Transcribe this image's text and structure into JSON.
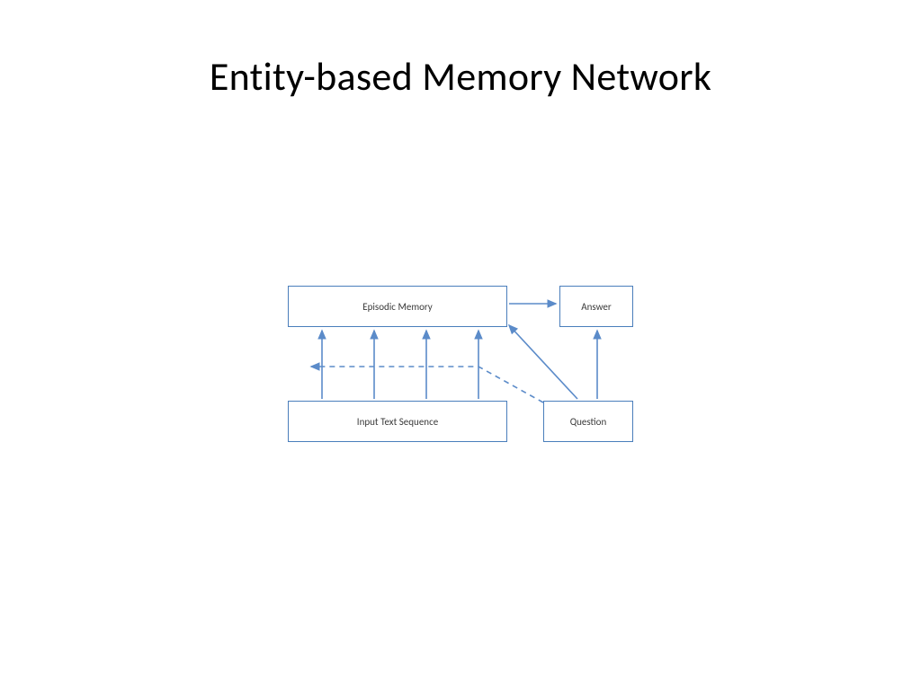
{
  "slide": {
    "title": "Entity-based Memory Network"
  },
  "diagram": {
    "boxes": {
      "episodic_memory": "Episodic Memory",
      "answer": "Answer",
      "input_text_sequence": "Input Text Sequence",
      "question": "Question"
    },
    "arrows": [
      {
        "from": "input_text_sequence",
        "to": "episodic_memory",
        "style": "solid",
        "count": 4
      },
      {
        "from": "question",
        "to": "episodic_memory",
        "style": "solid",
        "count": 1
      },
      {
        "from": "question",
        "to": "answer",
        "style": "solid",
        "count": 1
      },
      {
        "from": "episodic_memory",
        "to": "answer",
        "style": "solid",
        "count": 1
      },
      {
        "from": "question",
        "to": "input_text_sequence",
        "style": "dashed",
        "note": "back-reference"
      }
    ],
    "colors": {
      "box_border": "#4a7ebb",
      "arrow": "#5b8bc9"
    }
  }
}
